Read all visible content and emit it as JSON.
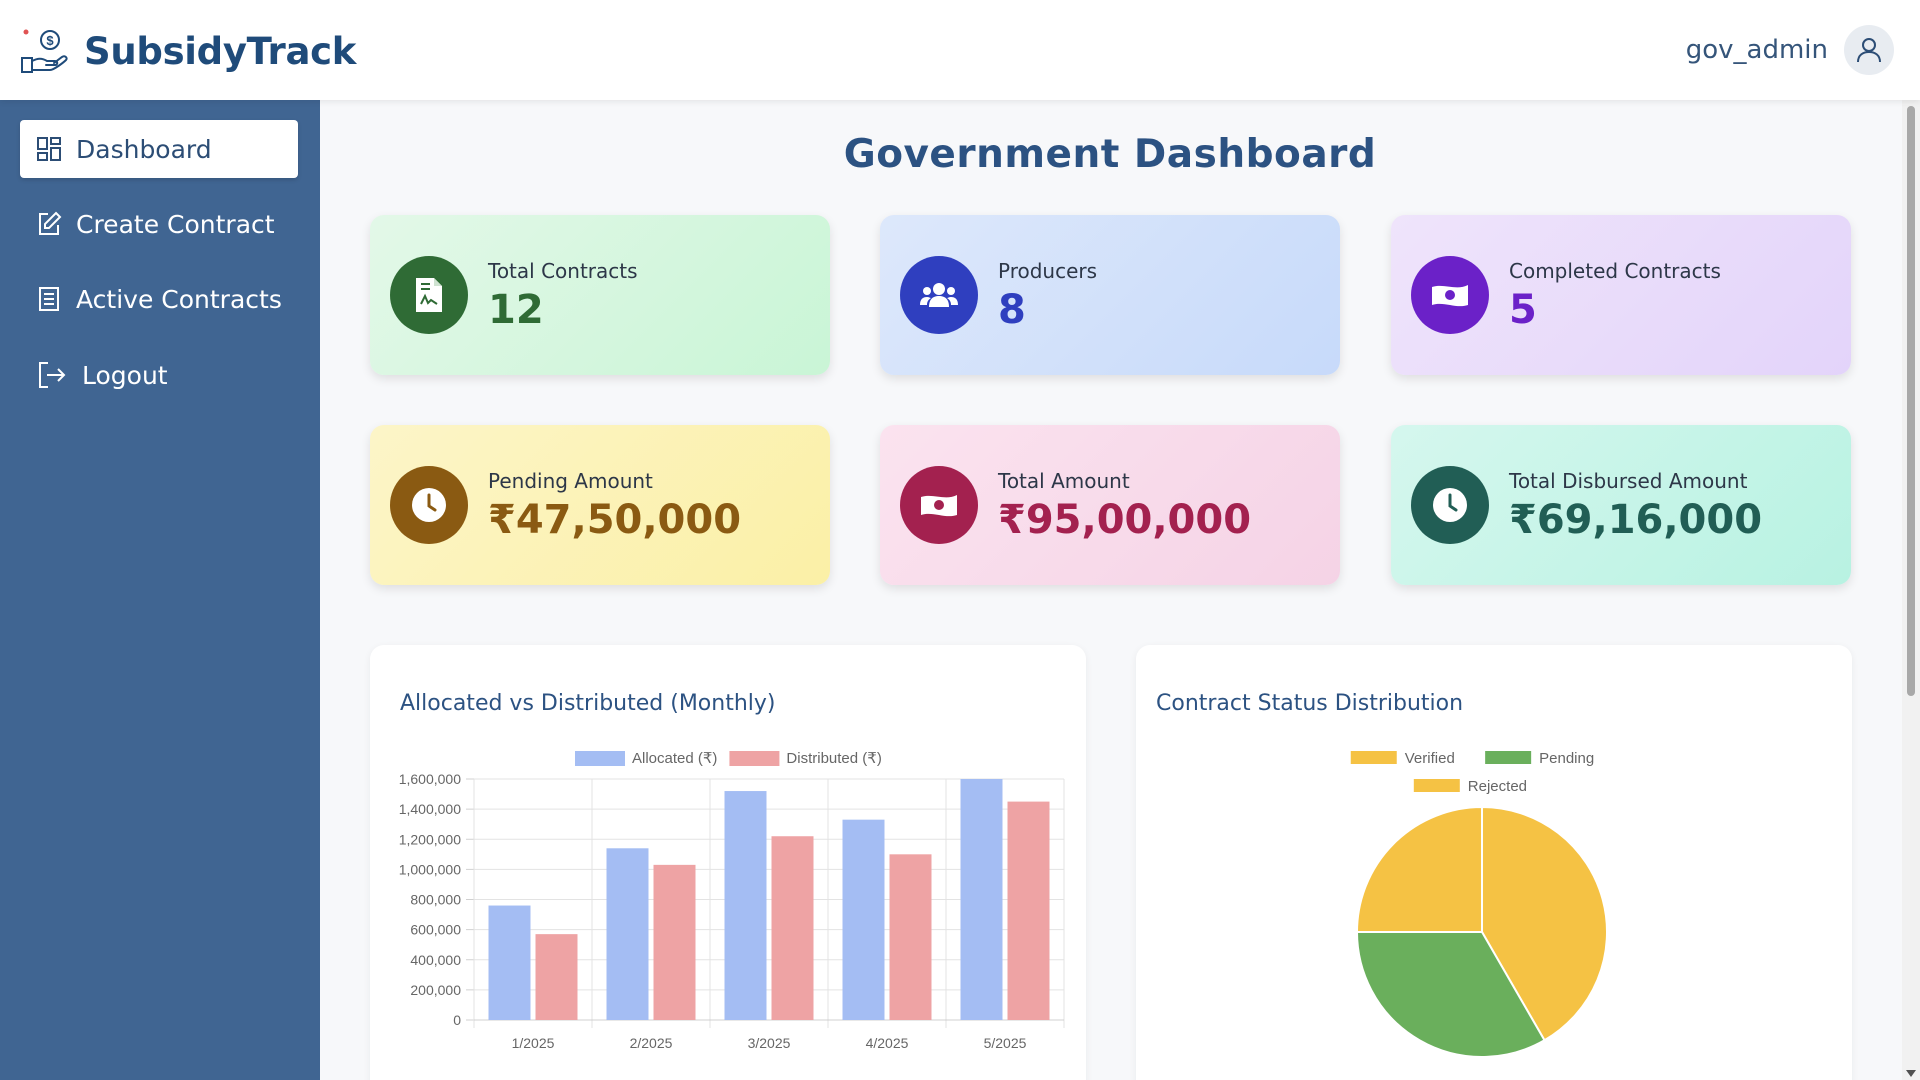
{
  "app": {
    "name": "SubsidyTrack",
    "logo_icon": "hand-money-icon"
  },
  "user": {
    "name": "gov_admin",
    "icon": "user-icon"
  },
  "sidebar": {
    "items": [
      {
        "label": "Dashboard",
        "icon": "grid-icon",
        "active": true
      },
      {
        "label": "Create Contract",
        "icon": "edit-icon"
      },
      {
        "label": "Active Contracts",
        "icon": "document-list-icon"
      },
      {
        "label": "Logout",
        "icon": "logout-icon"
      }
    ]
  },
  "page": {
    "title": "Government Dashboard"
  },
  "stats": [
    {
      "label": "Total Contracts",
      "value": "12",
      "icon": "contract-document-icon",
      "color": "#2f6b35"
    },
    {
      "label": "Producers",
      "value": "8",
      "icon": "users-icon",
      "color": "#2f3fbf"
    },
    {
      "label": "Completed Contracts",
      "value": "5",
      "icon": "money-bill-icon",
      "color": "#6b21c8"
    },
    {
      "label": "Pending Amount",
      "value": "₹47,50,000",
      "icon": "clock-icon",
      "color": "#8a5a12"
    },
    {
      "label": "Total Amount",
      "value": "₹95,00,000",
      "icon": "money-bill-icon",
      "color": "#a3214f"
    },
    {
      "label": "Total Disbursed Amount",
      "value": "₹69,16,000",
      "icon": "clock-icon",
      "color": "#215e55"
    }
  ],
  "charts": {
    "bar_title": "Allocated vs Distributed (Monthly)",
    "pie_title": "Contract Status Distribution"
  },
  "chart_data": [
    {
      "type": "bar",
      "title": "Allocated vs Distributed (Monthly)",
      "categories": [
        "1/2025",
        "2/2025",
        "3/2025",
        "4/2025",
        "5/2025"
      ],
      "series": [
        {
          "name": "Allocated (₹)",
          "values": [
            760000,
            1140000,
            1520000,
            1330000,
            1600000
          ],
          "color": "#a4bdf3"
        },
        {
          "name": "Distributed (₹)",
          "values": [
            570000,
            1030000,
            1220000,
            1100000,
            1450000
          ],
          "color": "#eea3a4"
        }
      ],
      "ylim": [
        0,
        1600000
      ],
      "yticks": [
        "0",
        "200,000",
        "400,000",
        "600,000",
        "800,000",
        "1,000,000",
        "1,200,000",
        "1,400,000",
        "1,600,000"
      ],
      "grid": true,
      "legend": "top"
    },
    {
      "type": "pie",
      "title": "Contract Status Distribution",
      "series": [
        {
          "name": "Verified",
          "value": 5,
          "color": "#f5c244"
        },
        {
          "name": "Pending",
          "value": 4,
          "color": "#6aaf5c"
        },
        {
          "name": "Rejected",
          "value": 3,
          "color": "#f5c244"
        }
      ],
      "legend": "top"
    }
  ]
}
